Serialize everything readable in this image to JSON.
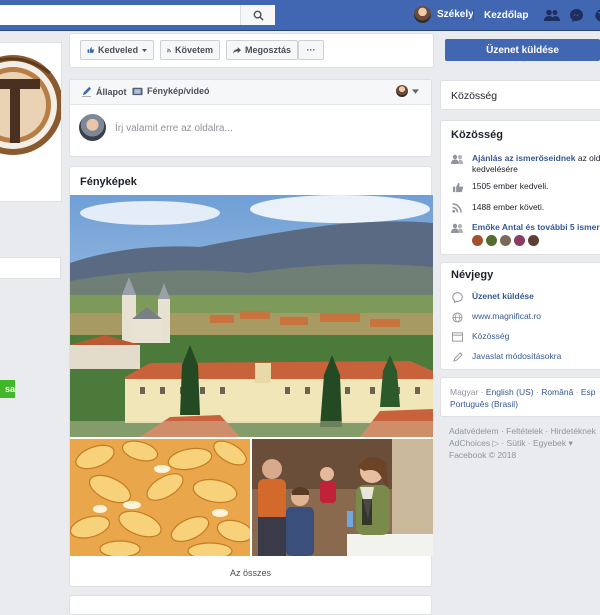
{
  "topbar": {
    "user_name": "Székely",
    "home_label": "Kezdőlap"
  },
  "left": {
    "button_partial": "sa"
  },
  "page_actions": {
    "like_label": "Kedveled",
    "follow_label": "Követem",
    "share_label": "Megosztás",
    "more_label": "···"
  },
  "composer": {
    "tab_status": "Állapot",
    "tab_photo": "Fénykép/videó",
    "placeholder": "Írj valamit erre az oldalra..."
  },
  "photos": {
    "title": "Fényképek",
    "see_all": "Az összes"
  },
  "right": {
    "message_button": "Üzenet küldése",
    "community_header": "Közösség",
    "community": {
      "title": "Közösség",
      "invite_link": "Ajánlás az ismerőseidnek",
      "invite_rest": "az old",
      "invite_line2": "kedvelésére",
      "likes_text": "1505 ember kedveli.",
      "follows_text": "1488 ember követi.",
      "friends_link": "Emőke Antal és további 5 ismer"
    },
    "about": {
      "title": "Névjegy",
      "message_link": "Üzenet küldése",
      "website": "www.magnificat.ro",
      "category": "Közösség",
      "suggest_edits": "Javaslat módosításokra"
    },
    "languages": {
      "line1_a": "Magyar",
      "line1_b": "English (US)",
      "line1_c": "Română",
      "line1_d": "Esp",
      "line2": "Português (Brasil)"
    },
    "footer": {
      "line1": "Adatvédelem · Feltételek · Hirdetéknek",
      "line2": "AdChoices ▷ · Sütik · Egyebek ▾",
      "line3": "Facebook © 2018"
    }
  },
  "colors": {
    "brand": "#4267b2",
    "link": "#365899",
    "green": "#42b72a"
  }
}
